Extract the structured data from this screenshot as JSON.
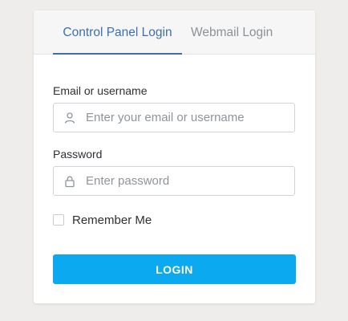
{
  "tabs": [
    {
      "label": "Control Panel Login",
      "active": true
    },
    {
      "label": "Webmail Login",
      "active": false
    }
  ],
  "form": {
    "email_label": "Email or username",
    "email_placeholder": "Enter your email or username",
    "email_icon": "user-icon",
    "password_label": "Password",
    "password_placeholder": "Enter password",
    "password_icon": "lock-icon",
    "remember_label": "Remember Me",
    "remember_checked": false,
    "login_button": "LOGIN"
  },
  "colors": {
    "accent": "#3d6fb0",
    "button": "#0ba9ef",
    "background": "#eeedeb"
  }
}
